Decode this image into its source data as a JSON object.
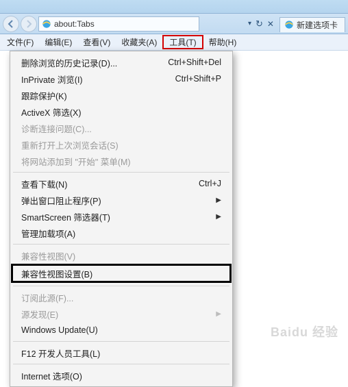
{
  "title_bar": {},
  "addr": {
    "url": "about:Tabs",
    "tab_label": "新建选项卡",
    "refresh_tip": "refresh",
    "stop_tip": "stop"
  },
  "menubar": {
    "file": "文件(F)",
    "edit": "编辑(E)",
    "view": "查看(V)",
    "favorites": "收藏夹(A)",
    "tools": "工具(T)",
    "help": "帮助(H)"
  },
  "tools_menu": {
    "delete_history": "删除浏览的历史记录(D)...",
    "delete_history_sc": "Ctrl+Shift+Del",
    "inprivate": "InPrivate 浏览(I)",
    "inprivate_sc": "Ctrl+Shift+P",
    "tracking": "跟踪保护(K)",
    "activex": "ActiveX 筛选(X)",
    "diagnose": "诊断连接问题(C)...",
    "reopen": "重新打开上次浏览会话(S)",
    "add_start": "将网站添加到 \"开始\" 菜单(M)",
    "downloads": "查看下载(N)",
    "downloads_sc": "Ctrl+J",
    "popup": "弹出窗口阻止程序(P)",
    "smartscreen": "SmartScreen 筛选器(T)",
    "addons": "管理加载项(A)",
    "compat_view": "兼容性视图(V)",
    "compat_settings": "兼容性视图设置(B)",
    "subscribe": "订阅此源(F)...",
    "feed_discovery": "源发现(E)",
    "win_update": "Windows Update(U)",
    "f12": "F12 开发人员工具(L)",
    "internet_options": "Internet 选项(O)"
  },
  "watermark": "Baidu 经验"
}
